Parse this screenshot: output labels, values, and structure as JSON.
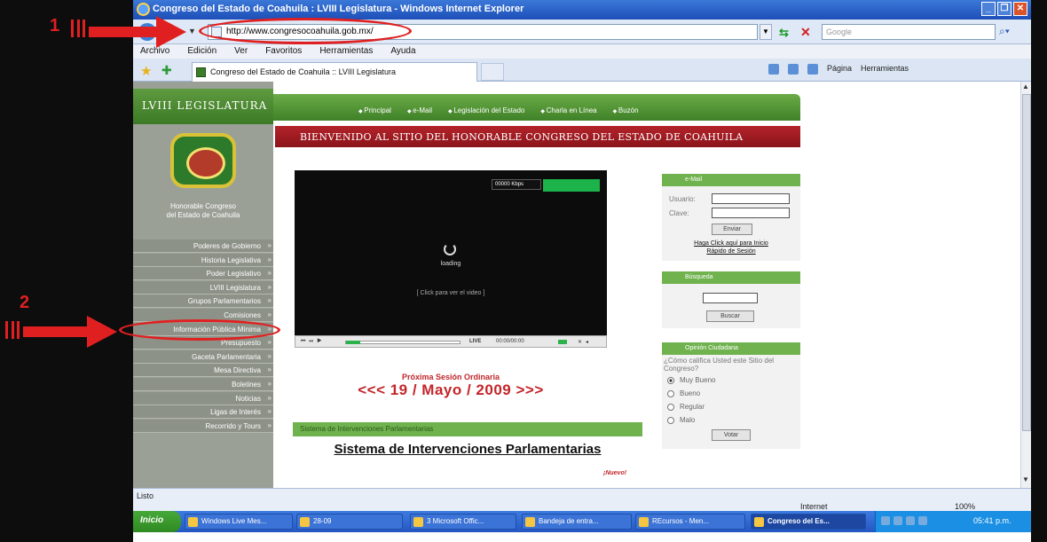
{
  "window": {
    "title": "Congreso del Estado de Coahuila : LVIII Legislatura - Windows Internet Explorer",
    "controls": [
      "_",
      "❐",
      "✕"
    ]
  },
  "address_bar": {
    "url": "http://www.congresocoahuila.gob.mx/",
    "search_placeholder": "Google"
  },
  "menu": [
    "Archivo",
    "Edición",
    "Ver",
    "Favoritos",
    "Herramientas",
    "Ayuda"
  ],
  "tab": {
    "label": "Congreso del Estado de Coahuila :: LVIII Legislatura"
  },
  "command_bar": [
    "Página",
    "Herramientas"
  ],
  "site": {
    "legislature_banner": "LVIII LEGISLATURA",
    "top_nav": [
      "Principal",
      "e-Mail",
      "Legislación del Estado",
      "Charla en Línea",
      "Buzón"
    ],
    "welcome_banner": "BIENVENIDO AL SITIO DEL HONORABLE CONGRESO DEL ESTADO DE COAHUILA",
    "org_name_line1": "Honorable Congreso",
    "org_name_line2": "del Estado de Coahuila",
    "side_menu": [
      "Poderes de Gobierno",
      "Historia Legislativa",
      "Poder Legislativo",
      "LVIII Legislatura",
      "Grupos Parlamentarios",
      "Comisiones",
      "Información Pública Mínima",
      "Presupuesto",
      "Gaceta Parlamentaria",
      "Mesa Directiva",
      "Boletines",
      "Noticias",
      "Ligas de Interés",
      "Recorrido y Tours"
    ],
    "video": {
      "kbps": "00000 Kbps",
      "loading": "loading",
      "click_hint": "[ Click para ver el video ]",
      "live": "LIVE",
      "time": "00:00/00:00"
    },
    "next_session_label": "Próxima Sesión Ordinaria",
    "next_session_date": "<<< 19 / Mayo / 2009 >>>",
    "sip_strip": "Sistema de Intervenciones Parlamentarias",
    "sip_title": "Sistema de Intervenciones Parlamentarias",
    "nuevo": "¡Nuevo!",
    "email_widget": {
      "header": "e-Mail",
      "user_label": "Usuario:",
      "pass_label": "Clave:",
      "send_button": "Enviar",
      "link_line1": "Haga Click aquí para Inicio",
      "link_line2": "Rápido de Sesión"
    },
    "search_widget": {
      "header": "Búsqueda",
      "button": "Buscar"
    },
    "poll_widget": {
      "header": "Opinión Ciudadana",
      "question": "¿Cómo califica Usted este Sitio del Congreso?",
      "options": [
        "Muy Bueno",
        "Bueno",
        "Regular",
        "Malo"
      ],
      "selected": "Muy Bueno",
      "vote_button": "Votar"
    }
  },
  "status_bar": {
    "text": "Listo",
    "zone": "Internet",
    "zoom": "100%"
  },
  "taskbar": {
    "start": "Inicio",
    "tasks": [
      "Windows Live Mes...",
      "28-09",
      "3 Microsoft Offic...",
      "Bandeja de entra...",
      "REcursos - Men...",
      "Congreso del Es..."
    ],
    "clock": "05:41 p.m."
  },
  "annotations": {
    "one": "1",
    "two": "2",
    "color": "#e02020"
  }
}
